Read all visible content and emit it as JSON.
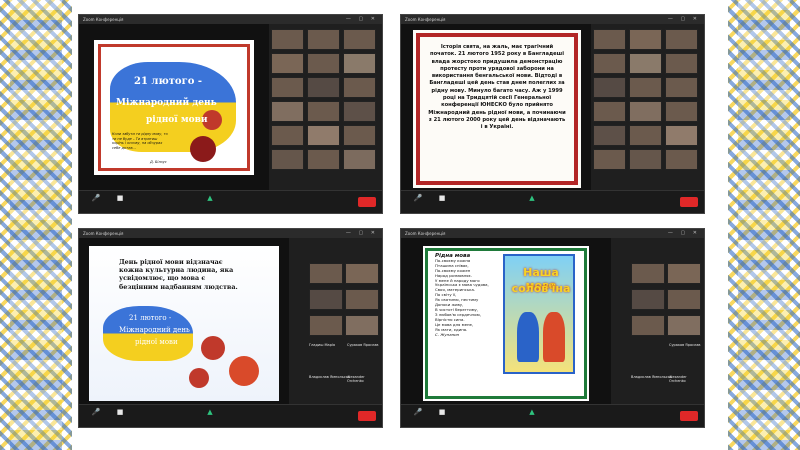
{
  "decor": {
    "border_colors": {
      "blue": "#2a63c8",
      "yellow": "#f6d21c"
    }
  },
  "shots": [
    {
      "title": "Zoom Конференція",
      "slide": {
        "line1": "21 лютого -",
        "line2": "Міжнародний день",
        "line3": "рідної мови",
        "poem": "Коли забути ти рідну мову, то ти не буде – Ти втратиш корінь і основу, на обчурах себе дотла...",
        "author": "Д. Білоус"
      }
    },
    {
      "title": "Zoom Конференція",
      "slide": {
        "text": "Історія свята, на жаль, має трагічний початок. 21 лютого 1952 року в Бангладеші влада жорстоко придушила демонстрацію протесту проти урядової заборони на використання бенгальської мови. Відтоді в Бангладеші цей день став днем полеглих за рідну мову. Минуло багато часу. Аж у 1999 році на Тридцятій сесії Генеральної конференції ЮНЕСКО було прийнято Міжнародний день рідної мови, а починаючи з 21 лютого 2000 року цей день відзначають і в Україні."
      }
    },
    {
      "title": "Zoom Конференція",
      "slide": {
        "headline": "День рідної мови відзначає кожна культурна людина, яка усвідомлює, що мова є безцінним надбанням людства.",
        "line1": "21 лютого -",
        "line2": "Міжнародний день",
        "line3": "рідної мови"
      },
      "participants": [
        "Гладиш Марія",
        "Сураков Ярослав",
        "Владислав Ямпольськ",
        "Alexander Orchenko"
      ]
    },
    {
      "title": "Zoom Конференція",
      "slide": {
        "poem_title": "Рідна мова",
        "poem_lines": [
          "По-своєму кожна",
          "Пташина співає,",
          "По-своєму кожен",
          "Народ розмовляє.",
          "У мене й народу  мого",
          "Українська є мова чудова,",
          "Своя, материнська.",
          "По світу її,",
          "Як святиню, нестиму",
          "Допоки живу,",
          "В чистоті берегтиму,",
          "З любов'ю сердечною,",
          "Вірністю сина.",
          "Це мова для мене,",
          "Як мати, єдина."
        ],
        "poem_author": "С. Жупанин",
        "poster_line1": "Наша мова",
        "poster_line2": "солов'їна"
      },
      "participants": [
        "Сураков Ярослав",
        "Владислав Ямпольськ",
        "Alexander Orchenko"
      ]
    }
  ]
}
